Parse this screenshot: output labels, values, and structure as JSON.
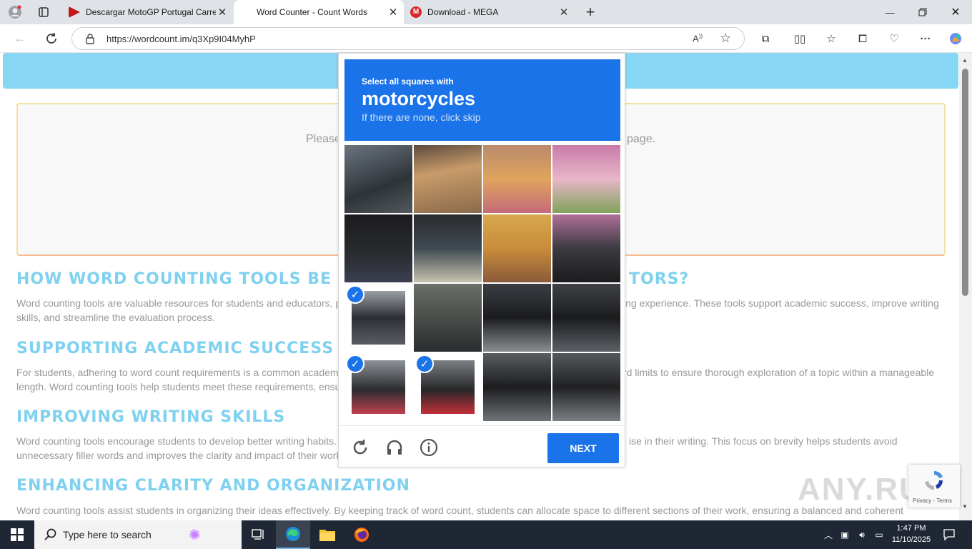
{
  "tabs": [
    {
      "label": "Descargar MotoGP Portugal Carrera",
      "active": false
    },
    {
      "label": "Word Counter - Count Words",
      "active": true
    },
    {
      "label": "Download - MEGA",
      "active": false
    }
  ],
  "address": {
    "url": "https://wordcount.im/q3Xp9I04MyhP"
  },
  "page": {
    "ad_text_left": "Please",
    "ad_text_right": "page.",
    "sections": [
      {
        "heading_left": "HOW WORD COUNTING TOOLS BE",
        "heading_right": "TORS?",
        "line1_left": "Word counting tools are valuable resources for students and educators, p",
        "line1_right": "ing experience. These tools support academic success, improve writing",
        "line2": "skills, and streamline the evaluation process."
      },
      {
        "heading_left": "SUPPORTING ACADEMIC SUCCESS",
        "line1_left": "For students, adhering to word count requirements is a common academ",
        "line1_right": "rd limits to ensure thorough exploration of a topic within a manageable",
        "line2": "length. Word counting tools help students meet these requirements, ensu"
      },
      {
        "heading_left": "IMPROVING WRITING SKILLS",
        "line1_left": "Word counting tools encourage students to develop better writing habits.",
        "line1_right": "ise in their writing. This focus on brevity helps students avoid",
        "line2": "unnecessary filler words and improves the clarity and impact of their work"
      },
      {
        "heading_left": "ENHANCING CLARITY AND ORGANIZATION",
        "line1_left": "Word counting tools assist students in organizing their ideas effectively. By keeping track of word count, students can allocate space to different sections of their work, ensuring a balanced and coherent"
      }
    ]
  },
  "captcha": {
    "instruction": "Select all squares with",
    "target": "motorcycles",
    "hint": "If there are none, click skip",
    "next_label": "NEXT",
    "selected_cells": [
      8,
      12,
      13
    ]
  },
  "recaptcha_badge": {
    "terms": "Privacy - Terms"
  },
  "watermark": "ANY.RUN",
  "taskbar": {
    "search_placeholder": "Type here to search",
    "time": "1:47 PM",
    "date": "11/10/2025"
  },
  "colors": {
    "accent": "#1a73e8",
    "heading": "#7fd1ef",
    "banner": "#87d7f4"
  }
}
